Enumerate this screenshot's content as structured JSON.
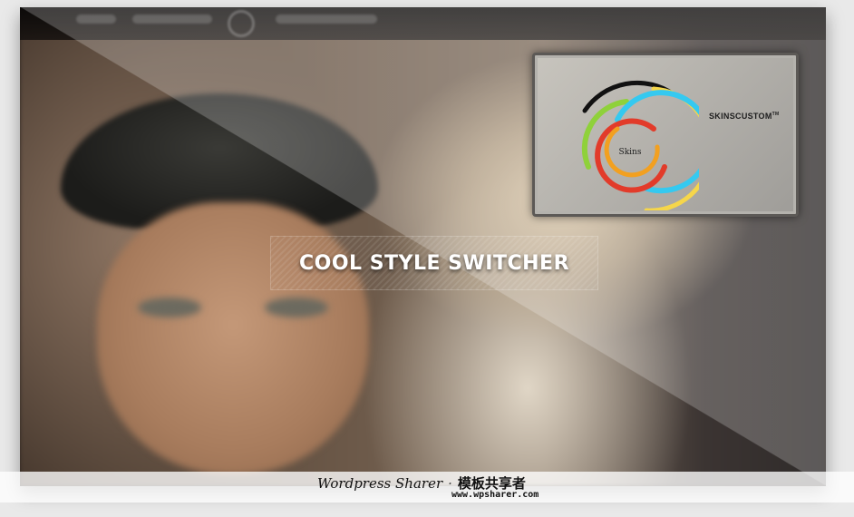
{
  "hero": {
    "title": "COOL STYLE SWITCHER"
  },
  "promo": {
    "rings_label": "Skins",
    "brand_prefix": "SKINS",
    "brand_suffix": "CUSTOM",
    "brand_mark": "TM",
    "ring_colors": [
      "#111111",
      "#f6d64a",
      "#8fd13a",
      "#35c9f0",
      "#e23b2a",
      "#f2a020"
    ]
  },
  "watermark": {
    "line1": "Wordpress Sharer",
    "line1_cn": "模板共享者",
    "line2": "www.wpsharer.com"
  }
}
